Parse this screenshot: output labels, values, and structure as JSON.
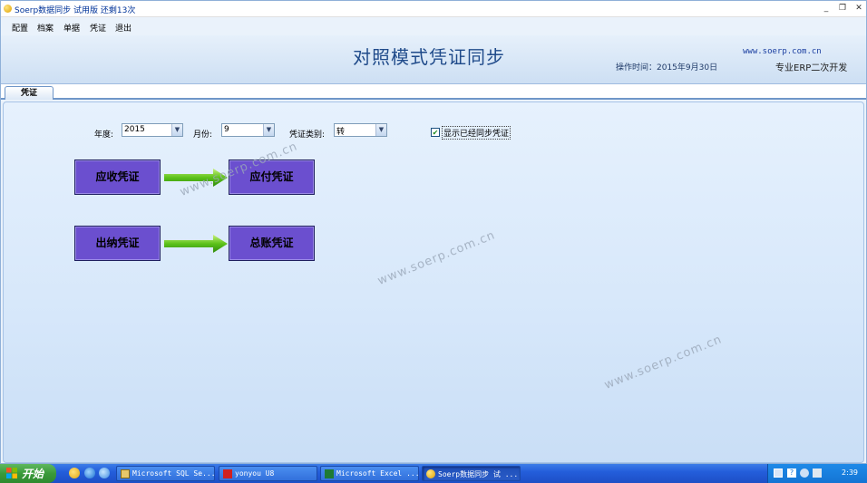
{
  "window": {
    "title": "Soerp数据同步 试用版  还剩13次",
    "minimize": "_",
    "maximize": "❐",
    "close": "✕"
  },
  "menu": [
    "配置",
    "档案",
    "单据",
    "凭证",
    "退出"
  ],
  "header": {
    "title": "对照模式凭证同步",
    "url": "www.soerp.com.cn",
    "operation_time": "操作时间：2015年9月30日",
    "slogan": "专业ERP二次开发"
  },
  "tab": {
    "label": "凭证"
  },
  "filters": {
    "year_label": "年度:",
    "year_value": "2015",
    "month_label": "月份:",
    "month_value": "9",
    "voucher_type_label": "凭证类别:",
    "voucher_type_value": "转",
    "show_synced_label": "显示已经同步凭证",
    "show_synced_checked": true
  },
  "buttons": {
    "receivable": "应收凭证",
    "payable": "应付凭证",
    "cashier": "出纳凭证",
    "ledger": "总账凭证"
  },
  "watermark": "www.soerp.com.cn",
  "taskbar": {
    "start": "开始",
    "tasks": [
      "Microsoft SQL Se...",
      "yonyou U8",
      "Microsoft Excel ...",
      "Soerp数据同步 试 ..."
    ],
    "clock": "2:39"
  },
  "colors": {
    "voucher_button": "#6b4fcf",
    "arrow": "#5cc21a",
    "taskbar": "#245edb",
    "start": "#3a9a3a"
  }
}
